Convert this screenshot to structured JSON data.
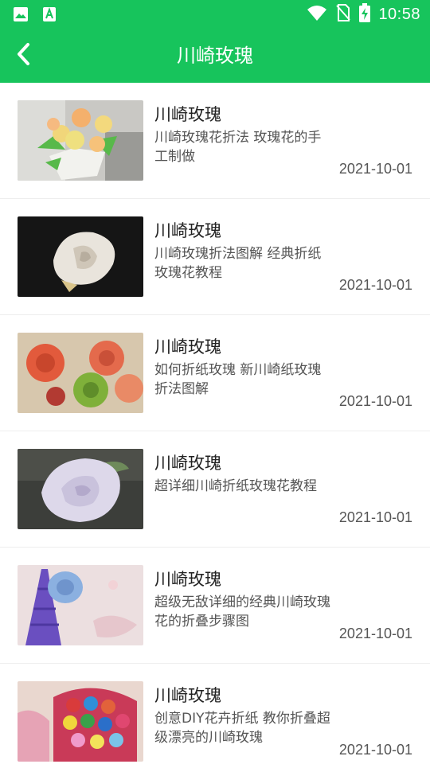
{
  "status_bar": {
    "time": "10:58",
    "left_icons": [
      "image-icon",
      "app-store-icon"
    ],
    "right_icons": [
      "wifi-icon",
      "no-sim-icon",
      "battery-charging-icon"
    ]
  },
  "app_bar": {
    "title": "川崎玫瑰",
    "back_icon": "chevron-left-icon"
  },
  "colors": {
    "accent": "#17c45c",
    "title_text": "#222222",
    "secondary_text": "#555555"
  },
  "items": [
    {
      "title": "川崎玫瑰",
      "description": "川崎玫瑰花折法 玫瑰花的手工制做",
      "date": "2021-10-01"
    },
    {
      "title": "川崎玫瑰",
      "description": "川崎玫瑰折法图解 经典折纸玫瑰花教程",
      "date": "2021-10-01"
    },
    {
      "title": "川崎玫瑰",
      "description": "如何折纸玫瑰 新川崎纸玫瑰折法图解",
      "date": "2021-10-01"
    },
    {
      "title": "川崎玫瑰",
      "description": "超详细川崎折纸玫瑰花教程",
      "date": "2021-10-01"
    },
    {
      "title": "川崎玫瑰",
      "description": "超级无敌详细的经典川崎玫瑰花的折叠步骤图",
      "date": "2021-10-01"
    },
    {
      "title": "川崎玫瑰",
      "description": "创意DIY花卉折纸 教你折叠超级漂亮的川崎玫瑰",
      "date": "2021-10-01"
    }
  ]
}
